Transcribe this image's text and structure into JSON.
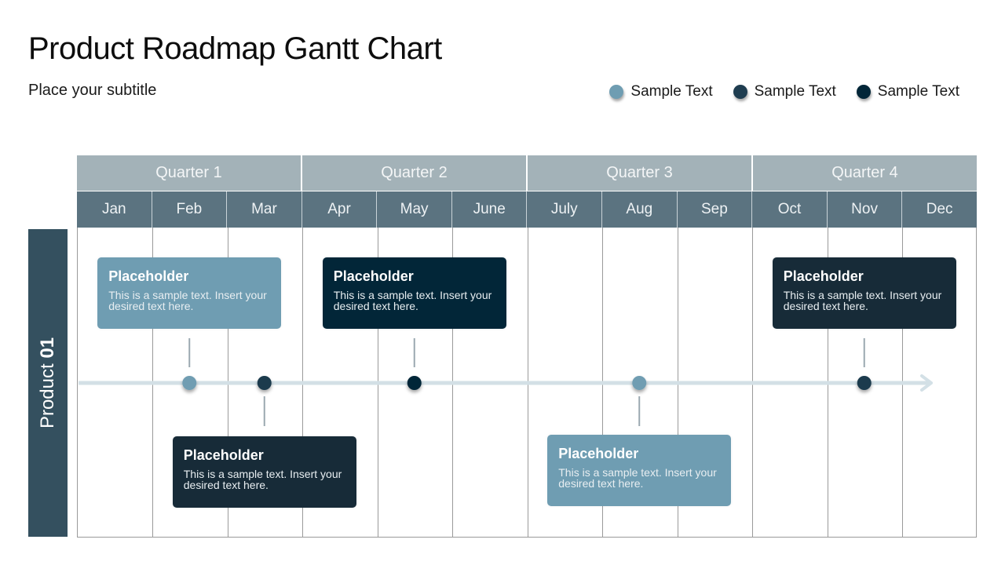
{
  "header": {
    "title": "Product Roadmap Gantt Chart",
    "subtitle": "Place your subtitle"
  },
  "colors": {
    "light": "#6f9db2",
    "medium": "#1a3a4d",
    "dark": "#022638",
    "charcoal": "#172b38",
    "timeline": "#d3e0e6",
    "connector": "#9aa8b0"
  },
  "legend": [
    {
      "label": "Sample Text",
      "color": "#6f9db2"
    },
    {
      "label": "Sample Text",
      "color": "#1f3d50"
    },
    {
      "label": "Sample Text",
      "color": "#022638"
    }
  ],
  "row": {
    "label_prefix": "Product ",
    "label_number": "01"
  },
  "chart_data": {
    "type": "timeline",
    "title": "Product Roadmap Gantt Chart",
    "quarters": [
      "Quarter 1",
      "Quarter 2",
      "Quarter 3",
      "Quarter 4"
    ],
    "categories": [
      "Jan",
      "Feb",
      "Mar",
      "Apr",
      "May",
      "June",
      "July",
      "Aug",
      "Sep",
      "Oct",
      "Nov",
      "Dec"
    ],
    "rows": [
      "Product 01"
    ],
    "milestones": [
      {
        "month_position": 1.5,
        "color": "#6f9db2",
        "card_side": "above",
        "card_color": "#6f9db2",
        "card_title": "Placeholder",
        "card_text": "This is a sample text. Insert your desired text here."
      },
      {
        "month_position": 2.5,
        "color": "#1a3a4d",
        "card_side": "below",
        "card_color": "#172b38",
        "card_title": "Placeholder",
        "card_text": "This is a sample text. Insert your desired text here."
      },
      {
        "month_position": 4.5,
        "color": "#022638",
        "card_side": "above",
        "card_color": "#022638",
        "card_title": "Placeholder",
        "card_text": "This is a sample text. Insert your desired text here."
      },
      {
        "month_position": 7.5,
        "color": "#6f9db2",
        "card_side": "below",
        "card_color": "#6f9db2",
        "card_title": "Placeholder",
        "card_text": "This is a sample text. Insert your desired text here."
      },
      {
        "month_position": 10.5,
        "color": "#1a3a4d",
        "card_side": "above",
        "card_color": "#172b38",
        "card_title": "Placeholder",
        "card_text": "This is a sample text. Insert your desired text here."
      }
    ]
  }
}
